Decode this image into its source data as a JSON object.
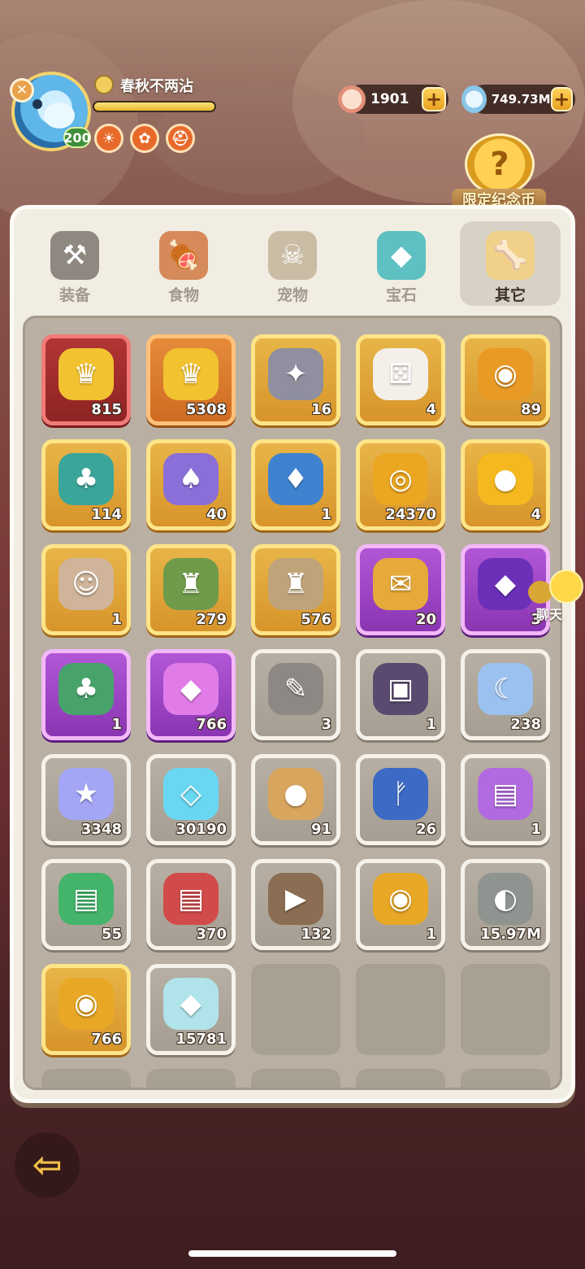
{
  "player": {
    "name": "春秋不两沾",
    "level": "200",
    "exp_fraction": 1.0,
    "badges": [
      "lion-icon",
      "gift-icon",
      "helmet-icon"
    ]
  },
  "resources": [
    {
      "icon": "shell-icon",
      "value": "1901"
    },
    {
      "icon": "stone-icon",
      "value": "749.73M"
    }
  ],
  "limited_coin": {
    "label": "限定纪念币",
    "glyph": "?"
  },
  "tabs": [
    {
      "label": "装备",
      "icon": "hammer-icon",
      "glyph": "⚒",
      "active": false
    },
    {
      "label": "食物",
      "icon": "food-bowl-icon",
      "glyph": "🍖",
      "active": false
    },
    {
      "label": "宠物",
      "icon": "pet-skull-icon",
      "glyph": "☠",
      "active": false
    },
    {
      "label": "宝石",
      "icon": "gem-icon",
      "glyph": "◆",
      "active": false
    },
    {
      "label": "其它",
      "icon": "bone-icon",
      "glyph": "🦴",
      "active": true
    }
  ],
  "items": [
    {
      "icon": "golden-dino-chest-icon",
      "glyph": "♛",
      "qty": "815",
      "rarity": "red",
      "bg": "#f2c230"
    },
    {
      "icon": "golden-dino-chest-icon",
      "glyph": "♛",
      "qty": "5308",
      "rarity": "orange",
      "bg": "#f2c230"
    },
    {
      "icon": "fossil-stone-icon",
      "glyph": "✦",
      "qty": "16",
      "rarity": "gold",
      "bg": "#8f8fa0"
    },
    {
      "icon": "dice-icon",
      "glyph": "⚄",
      "qty": "4",
      "rarity": "gold",
      "bg": "#f4efe8"
    },
    {
      "icon": "cake-coin-icon",
      "glyph": "◉",
      "qty": "89",
      "rarity": "gold",
      "bg": "#e89a25"
    },
    {
      "icon": "carrot-bag-icon",
      "glyph": "♣",
      "qty": "114",
      "rarity": "gold",
      "bg": "#3aa69a"
    },
    {
      "icon": "rabbit-bag-icon",
      "glyph": "♠",
      "qty": "40",
      "rarity": "gold",
      "bg": "#8a6fd8"
    },
    {
      "icon": "crystal-bag-icon",
      "glyph": "♦",
      "qty": "1",
      "rarity": "gold",
      "bg": "#3f83d0"
    },
    {
      "icon": "spiral-coin-icon",
      "glyph": "◎",
      "qty": "24370",
      "rarity": "gold",
      "bg": "#eba722"
    },
    {
      "icon": "amber-gem-icon",
      "glyph": "●",
      "qty": "4",
      "rarity": "gold",
      "bg": "#f5b91f"
    },
    {
      "icon": "caveman-portrait-icon",
      "glyph": "☺",
      "qty": "1",
      "rarity": "gold",
      "bg": "#d0b49a"
    },
    {
      "icon": "green-totem-icon",
      "glyph": "♜",
      "qty": "279",
      "rarity": "gold",
      "bg": "#6f9a4a"
    },
    {
      "icon": "stone-totem-icon",
      "glyph": "♜",
      "qty": "576",
      "rarity": "gold",
      "bg": "#bfa47a"
    },
    {
      "icon": "gift-bag-icon",
      "glyph": "✉",
      "qty": "20",
      "rarity": "purple",
      "bg": "#e7a93a"
    },
    {
      "icon": "purple-crystal-icon",
      "glyph": "◆",
      "qty": "3",
      "rarity": "purple",
      "bg": "#6b2fb8"
    },
    {
      "icon": "gem-bag-icon",
      "glyph": "♣",
      "qty": "1",
      "rarity": "purple",
      "bg": "#47a36b"
    },
    {
      "icon": "pink-crystal-icon",
      "glyph": "◆",
      "qty": "766",
      "rarity": "purple",
      "bg": "#e07be8"
    },
    {
      "icon": "stone-tablet-icon",
      "glyph": "✎",
      "qty": "3",
      "rarity": "gray",
      "bg": "#8e8884"
    },
    {
      "icon": "treasure-chest-icon",
      "glyph": "▣",
      "qty": "1",
      "rarity": "gray",
      "bg": "#5b4a6f"
    },
    {
      "icon": "moon-icon",
      "glyph": "☾",
      "qty": "238",
      "rarity": "gray",
      "bg": "#9bc1ee"
    },
    {
      "icon": "star-icon",
      "glyph": "★",
      "qty": "3348",
      "rarity": "gray",
      "bg": "#a3a6f5"
    },
    {
      "icon": "blue-shard-icon",
      "glyph": "◇",
      "qty": "30190",
      "rarity": "gray",
      "bg": "#6ad7f2"
    },
    {
      "icon": "spotted-bag-icon",
      "glyph": "●",
      "qty": "91",
      "rarity": "gray",
      "bg": "#d8a55f"
    },
    {
      "icon": "blue-rune-icon",
      "glyph": "ᚠ",
      "qty": "26",
      "rarity": "gray",
      "bg": "#3c6ac4"
    },
    {
      "icon": "purple-card-icon",
      "glyph": "▤",
      "qty": "1",
      "rarity": "gray",
      "bg": "#b26ae0"
    },
    {
      "icon": "green-card-icon",
      "glyph": "▤",
      "qty": "55",
      "rarity": "gray",
      "bg": "#43b46a"
    },
    {
      "icon": "red-card-icon",
      "glyph": "▤",
      "qty": "370",
      "rarity": "gray",
      "bg": "#d24b4b"
    },
    {
      "icon": "brown-card-icon",
      "glyph": "▶",
      "qty": "132",
      "rarity": "gray",
      "bg": "#8a6d52"
    },
    {
      "icon": "shell-coin-icon",
      "glyph": "◉",
      "qty": "1",
      "rarity": "gray",
      "bg": "#e8a825"
    },
    {
      "icon": "rune-stone-icon",
      "glyph": "◐",
      "qty": "15.97M",
      "rarity": "gray",
      "bg": "#8f9490"
    },
    {
      "icon": "dino-coin-icon",
      "glyph": "◉",
      "qty": "766",
      "rarity": "gold",
      "bg": "#e8a825"
    },
    {
      "icon": "rainbow-crystal-icon",
      "glyph": "◆",
      "qty": "15781",
      "rarity": "gray",
      "bg": "#b0e3ea"
    }
  ],
  "empty_slots": 8,
  "chat": {
    "label": "聊天"
  }
}
